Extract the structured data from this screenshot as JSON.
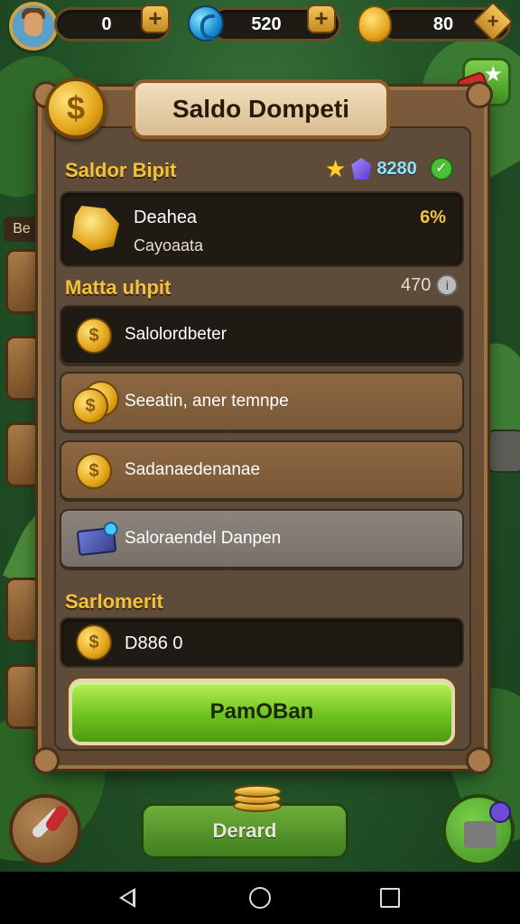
{
  "topbar": {
    "resource1_value": "0",
    "resource2_value": "520",
    "resource3_value": "80",
    "plus_label": "+",
    "diamond_label": "+"
  },
  "side": {
    "label": "Be"
  },
  "panel": {
    "title": "Saldo Dompeti",
    "coin_symbol": "$",
    "section1_title": "Saldor Bipit",
    "stat_value": "8280",
    "featured": {
      "title": "Deahea",
      "subtitle": "Cayoaata",
      "percent": "6%"
    },
    "section2_title": "Matta uhpit",
    "count_value": "470",
    "options": [
      {
        "label": "Salolordbeter",
        "icon": "coin-icon"
      },
      {
        "label": "Seeatin, aner temnpe",
        "icon": "coin-stack-icon"
      },
      {
        "label": "Sadanaedenanae",
        "icon": "coin-icon"
      },
      {
        "label": "Saloraendel Danpen",
        "icon": "cash-icon"
      }
    ],
    "section3_title": "Sarlomerit",
    "amount_value": "D886 0",
    "primary_button": "PamOBan"
  },
  "bottom": {
    "button_label": "Derard"
  },
  "colors": {
    "accent_gold": "#f2c23a",
    "button_green": "#6fc21e",
    "panel_brown": "#5e4b39"
  }
}
